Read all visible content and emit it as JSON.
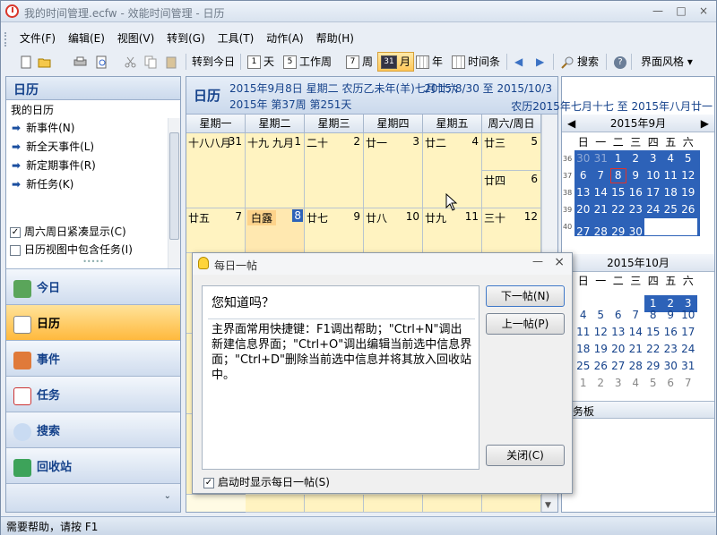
{
  "window": {
    "title": "我的时间管理.ecfw - 效能时间管理 - 日历",
    "controls": [
      "—",
      "□",
      "×"
    ]
  },
  "menu": [
    "文件(F)",
    "编辑(E)",
    "视图(V)",
    "转到(G)",
    "工具(T)",
    "动作(A)",
    "帮助(H)"
  ],
  "toolbar": {
    "goto_today": "转到今日",
    "day": "天",
    "work_week": "工作周",
    "week": "周",
    "month": "月",
    "year": "年",
    "timeline": "时间条",
    "search": "搜索",
    "ui_style": "界面风格",
    "day_num": "1",
    "work_week_num": "5",
    "week_num": "7",
    "month_num": "31"
  },
  "left": {
    "header": "日历",
    "my_calendar": "我的日历",
    "items": [
      "新事件(N)",
      "新全天事件(L)",
      "新定期事件(R)",
      "新任务(K)"
    ],
    "options": [
      {
        "label": "周六周日紧凑显示(C)",
        "checked": true
      },
      {
        "label": "日历视图中包含任务(I)",
        "checked": false
      }
    ],
    "nav": [
      "今日",
      "日历",
      "事件",
      "任务",
      "搜索",
      "回收站"
    ]
  },
  "main": {
    "title": "日历",
    "date_line": "2015年9月8日 星期二 农历乙未年(羊)七月廿六",
    "week_line": "2015年 第37周 第251天",
    "range": "2015/8/30 至 2015/10/3",
    "lunar_range": "农历2015年七月十七 至 2015年八月廿一",
    "days": [
      "星期一",
      "星期二",
      "星期三",
      "星期四",
      "星期五",
      "周六/周日"
    ],
    "week1": [
      {
        "lunar": "十八八月",
        "num": "31"
      },
      {
        "lunar": "十九 九月",
        "num": "1"
      },
      {
        "lunar": "二十",
        "num": "2"
      },
      {
        "lunar": "廿一",
        "num": "3"
      },
      {
        "lunar": "廿二",
        "num": "4"
      },
      {
        "lunar": "廿三",
        "num": "5"
      },
      {
        "lunar": "廿四",
        "num": "6"
      }
    ],
    "week2": [
      {
        "lunar": "廿五",
        "num": "7"
      },
      {
        "lunar": "白露",
        "num": "8"
      },
      {
        "lunar": "廿七",
        "num": "9"
      },
      {
        "lunar": "廿八",
        "num": "10"
      },
      {
        "lunar": "廿九",
        "num": "11"
      },
      {
        "lunar": "三十",
        "num": "12"
      }
    ]
  },
  "right": {
    "sep_title": "2015年9月",
    "oct_title": "2015年10月",
    "weekdays": [
      "日",
      "一",
      "二",
      "三",
      "四",
      "五",
      "六"
    ],
    "sep_weeks": [
      "36",
      "37",
      "38",
      "39",
      "40"
    ],
    "sep_rows": [
      [
        "30",
        "31",
        "1",
        "2",
        "3",
        "4",
        "5"
      ],
      [
        "6",
        "7",
        "8",
        "9",
        "10",
        "11",
        "12"
      ],
      [
        "13",
        "14",
        "15",
        "16",
        "17",
        "18",
        "19"
      ],
      [
        "20",
        "21",
        "22",
        "23",
        "24",
        "25",
        "26"
      ],
      [
        "27",
        "28",
        "29",
        "30",
        "",
        "",
        ""
      ]
    ],
    "oct_rows": [
      [
        "",
        "",
        "",
        "",
        "1",
        "2",
        "3"
      ],
      [
        "4",
        "5",
        "6",
        "7",
        "8",
        "9",
        "10"
      ],
      [
        "11",
        "12",
        "13",
        "14",
        "15",
        "16",
        "17"
      ],
      [
        "18",
        "19",
        "20",
        "21",
        "22",
        "23",
        "24"
      ],
      [
        "25",
        "26",
        "27",
        "28",
        "29",
        "30",
        "31"
      ],
      [
        "1",
        "2",
        "3",
        "4",
        "5",
        "6",
        "7"
      ]
    ],
    "taskboard": "务板"
  },
  "dialog": {
    "title": "每日一帖",
    "question": "您知道吗？",
    "text": "主界面常用快捷键：F1调出帮助；\"Ctrl+N\"调出新建信息界面；\"Ctrl+O\"调出编辑当前选中信息界面；\"Ctrl+D\"删除当前选中信息并将其放入回收站中。",
    "next": "下一帖(N)",
    "prev": "上一帖(P)",
    "close": "关闭(C)",
    "show_on_start": "启动时显示每日一帖(S)"
  },
  "status": "需要帮助，请按 F1",
  "colors": {
    "accent_blue": "#2d62b8",
    "cell_yellow": "#fff3c1",
    "selected_orange": "#ffc759"
  }
}
